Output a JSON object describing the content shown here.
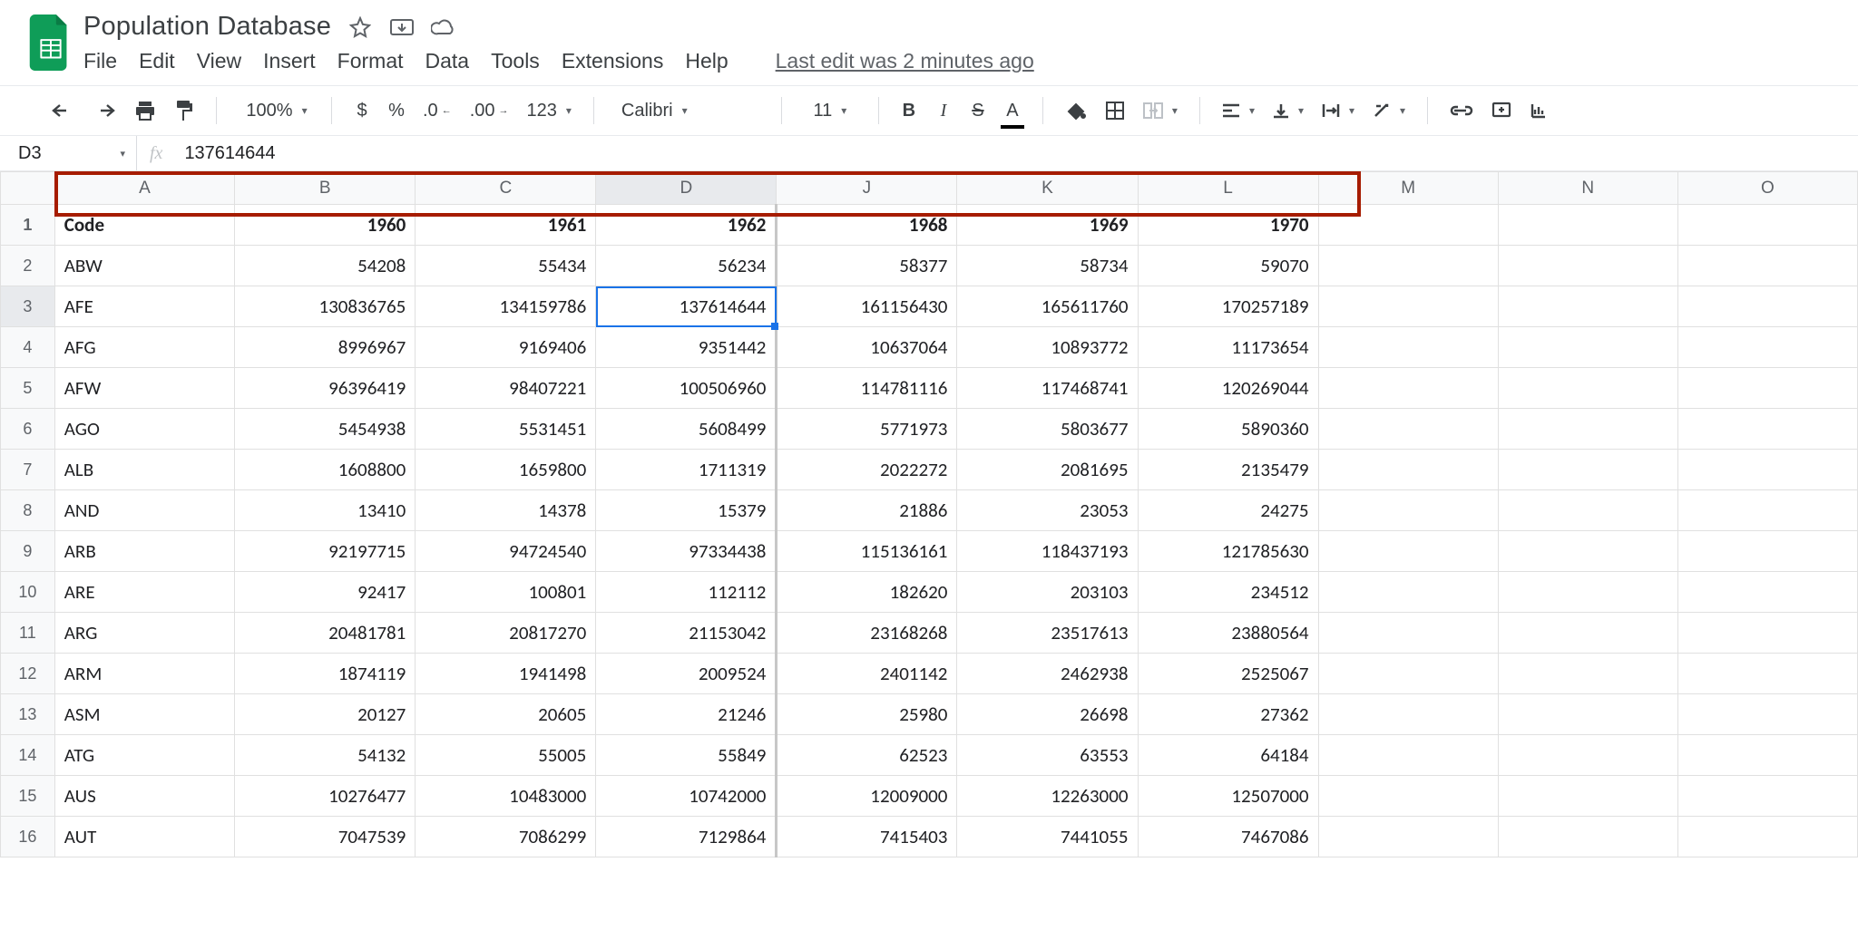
{
  "doc": {
    "title": "Population Database"
  },
  "menus": {
    "file": "File",
    "edit": "Edit",
    "view": "View",
    "insert": "Insert",
    "format": "Format",
    "data": "Data",
    "tools": "Tools",
    "extensions": "Extensions",
    "help": "Help",
    "last_edit": "Last edit was 2 minutes ago"
  },
  "toolbar": {
    "zoom": "100%",
    "font": "Calibri",
    "size": "11"
  },
  "namebox": "D3",
  "formula": "137614644",
  "columns": [
    "A",
    "B",
    "C",
    "D",
    "J",
    "K",
    "L",
    "M",
    "N",
    "O"
  ],
  "selected_col_index": 3,
  "header_row": {
    "code": "Code",
    "b": "1960",
    "c": "1961",
    "d": "1962",
    "j": "1968",
    "k": "1969",
    "l": "1970"
  },
  "rows": [
    {
      "n": 2,
      "code": "ABW",
      "b": "54208",
      "c": "55434",
      "d": "56234",
      "j": "58377",
      "k": "58734",
      "l": "59070"
    },
    {
      "n": 3,
      "code": "AFE",
      "b": "130836765",
      "c": "134159786",
      "d": "137614644",
      "j": "161156430",
      "k": "165611760",
      "l": "170257189"
    },
    {
      "n": 4,
      "code": "AFG",
      "b": "8996967",
      "c": "9169406",
      "d": "9351442",
      "j": "10637064",
      "k": "10893772",
      "l": "11173654"
    },
    {
      "n": 5,
      "code": "AFW",
      "b": "96396419",
      "c": "98407221",
      "d": "100506960",
      "j": "114781116",
      "k": "117468741",
      "l": "120269044"
    },
    {
      "n": 6,
      "code": "AGO",
      "b": "5454938",
      "c": "5531451",
      "d": "5608499",
      "j": "5771973",
      "k": "5803677",
      "l": "5890360"
    },
    {
      "n": 7,
      "code": "ALB",
      "b": "1608800",
      "c": "1659800",
      "d": "1711319",
      "j": "2022272",
      "k": "2081695",
      "l": "2135479"
    },
    {
      "n": 8,
      "code": "AND",
      "b": "13410",
      "c": "14378",
      "d": "15379",
      "j": "21886",
      "k": "23053",
      "l": "24275"
    },
    {
      "n": 9,
      "code": "ARB",
      "b": "92197715",
      "c": "94724540",
      "d": "97334438",
      "j": "115136161",
      "k": "118437193",
      "l": "121785630"
    },
    {
      "n": 10,
      "code": "ARE",
      "b": "92417",
      "c": "100801",
      "d": "112112",
      "j": "182620",
      "k": "203103",
      "l": "234512"
    },
    {
      "n": 11,
      "code": "ARG",
      "b": "20481781",
      "c": "20817270",
      "d": "21153042",
      "j": "23168268",
      "k": "23517613",
      "l": "23880564"
    },
    {
      "n": 12,
      "code": "ARM",
      "b": "1874119",
      "c": "1941498",
      "d": "2009524",
      "j": "2401142",
      "k": "2462938",
      "l": "2525067"
    },
    {
      "n": 13,
      "code": "ASM",
      "b": "20127",
      "c": "20605",
      "d": "21246",
      "j": "25980",
      "k": "26698",
      "l": "27362"
    },
    {
      "n": 14,
      "code": "ATG",
      "b": "54132",
      "c": "55005",
      "d": "55849",
      "j": "62523",
      "k": "63553",
      "l": "64184"
    },
    {
      "n": 15,
      "code": "AUS",
      "b": "10276477",
      "c": "10483000",
      "d": "10742000",
      "j": "12009000",
      "k": "12263000",
      "l": "12507000"
    },
    {
      "n": 16,
      "code": "AUT",
      "b": "7047539",
      "c": "7086299",
      "d": "7129864",
      "j": "7415403",
      "k": "7441055",
      "l": "7467086"
    }
  ],
  "selected_cell": {
    "row": 3,
    "col": "d"
  }
}
